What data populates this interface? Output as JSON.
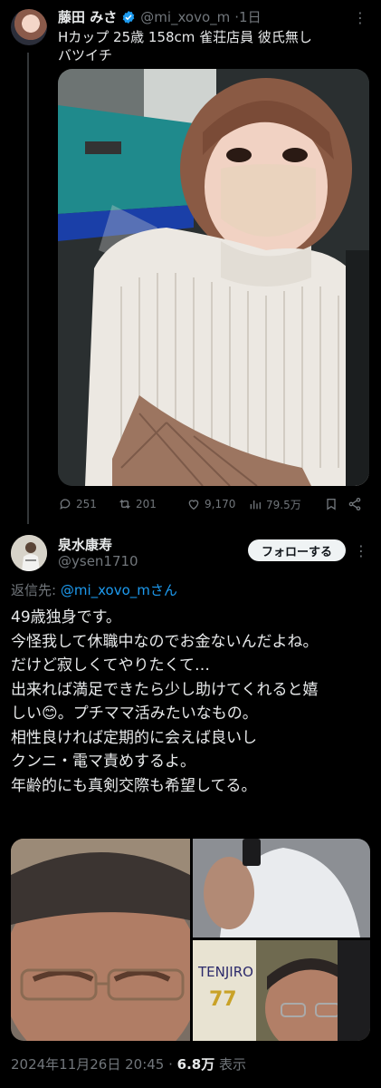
{
  "tweet": {
    "name": "藤田 みさ",
    "handle": "@mi_xovo_m",
    "time": "·1日",
    "text_line1": "Hカップ 25歳 158cm 雀荘店員 彼氏無し",
    "text_line2": "バツイチ",
    "stats": {
      "replies": "251",
      "retweets": "201",
      "likes": "9,170",
      "views": "79.5万"
    }
  },
  "reply": {
    "name": "泉水康寿",
    "handle": "@ysen1710",
    "follow_label": "フォローする",
    "reply_to_label": "返信先: ",
    "reply_to_handle": "@mi_xovo_mさん",
    "lines": [
      "49歳独身です。",
      "今怪我して休職中なのでお金ないんだよね。",
      "だけど寂しくてやりたくて…",
      "出来れば満足できたら少し助けてくれると嬉",
      "しい😊。プチママ活みたいなもの。",
      "相性良ければ定期的に会えば良いし",
      "クンニ・電マ責めするよ。",
      "年齢的にも真剣交際も希望してる。"
    ],
    "photo_text": "TENJIRO",
    "jersey_number": "77",
    "footer": {
      "datetime": "2024年11月26日 20:45",
      "separator": " · ",
      "views": "6.8万",
      "views_label": " 表示"
    }
  },
  "colors": {
    "background": "#000000",
    "text": "#e7e9ea",
    "muted": "#71767b",
    "link": "#1d9bf0",
    "verified": "#1d9bf0"
  }
}
